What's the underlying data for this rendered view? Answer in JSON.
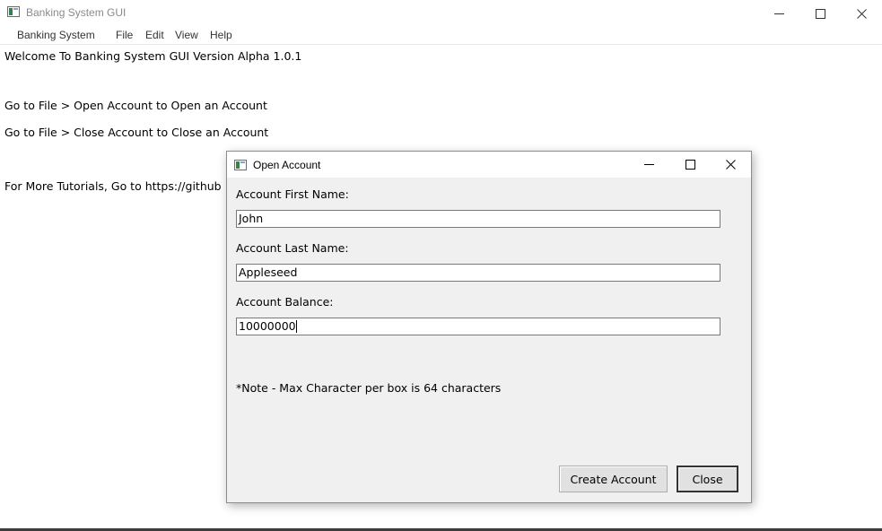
{
  "window": {
    "title": "Banking System GUI",
    "icon": "app-window-icon"
  },
  "menubar": {
    "items": [
      {
        "label": "Banking System"
      },
      {
        "label": "File"
      },
      {
        "label": "Edit"
      },
      {
        "label": "View"
      },
      {
        "label": "Help"
      }
    ]
  },
  "content": {
    "welcome": "Welcome To Banking System GUI Version Alpha 1.0.1",
    "open_hint": "Go to File > Open Account to Open an Account",
    "close_hint": "Go to File > Close Account to Close an Account",
    "tutorials": "For More Tutorials, Go to https://github"
  },
  "dialog": {
    "title": "Open Account",
    "fields": [
      {
        "label": "Account First Name:",
        "value": "John"
      },
      {
        "label": "Account Last Name:",
        "value": "Appleseed"
      },
      {
        "label": "Account Balance:",
        "value": "10000000"
      }
    ],
    "note": "*Note - Max Character per box is 64 characters",
    "buttons": {
      "create": "Create Account",
      "close": "Close"
    }
  },
  "colors": {
    "dialog_bg": "#f0f0f0",
    "title_text_inactive": "#8a8a8a"
  }
}
